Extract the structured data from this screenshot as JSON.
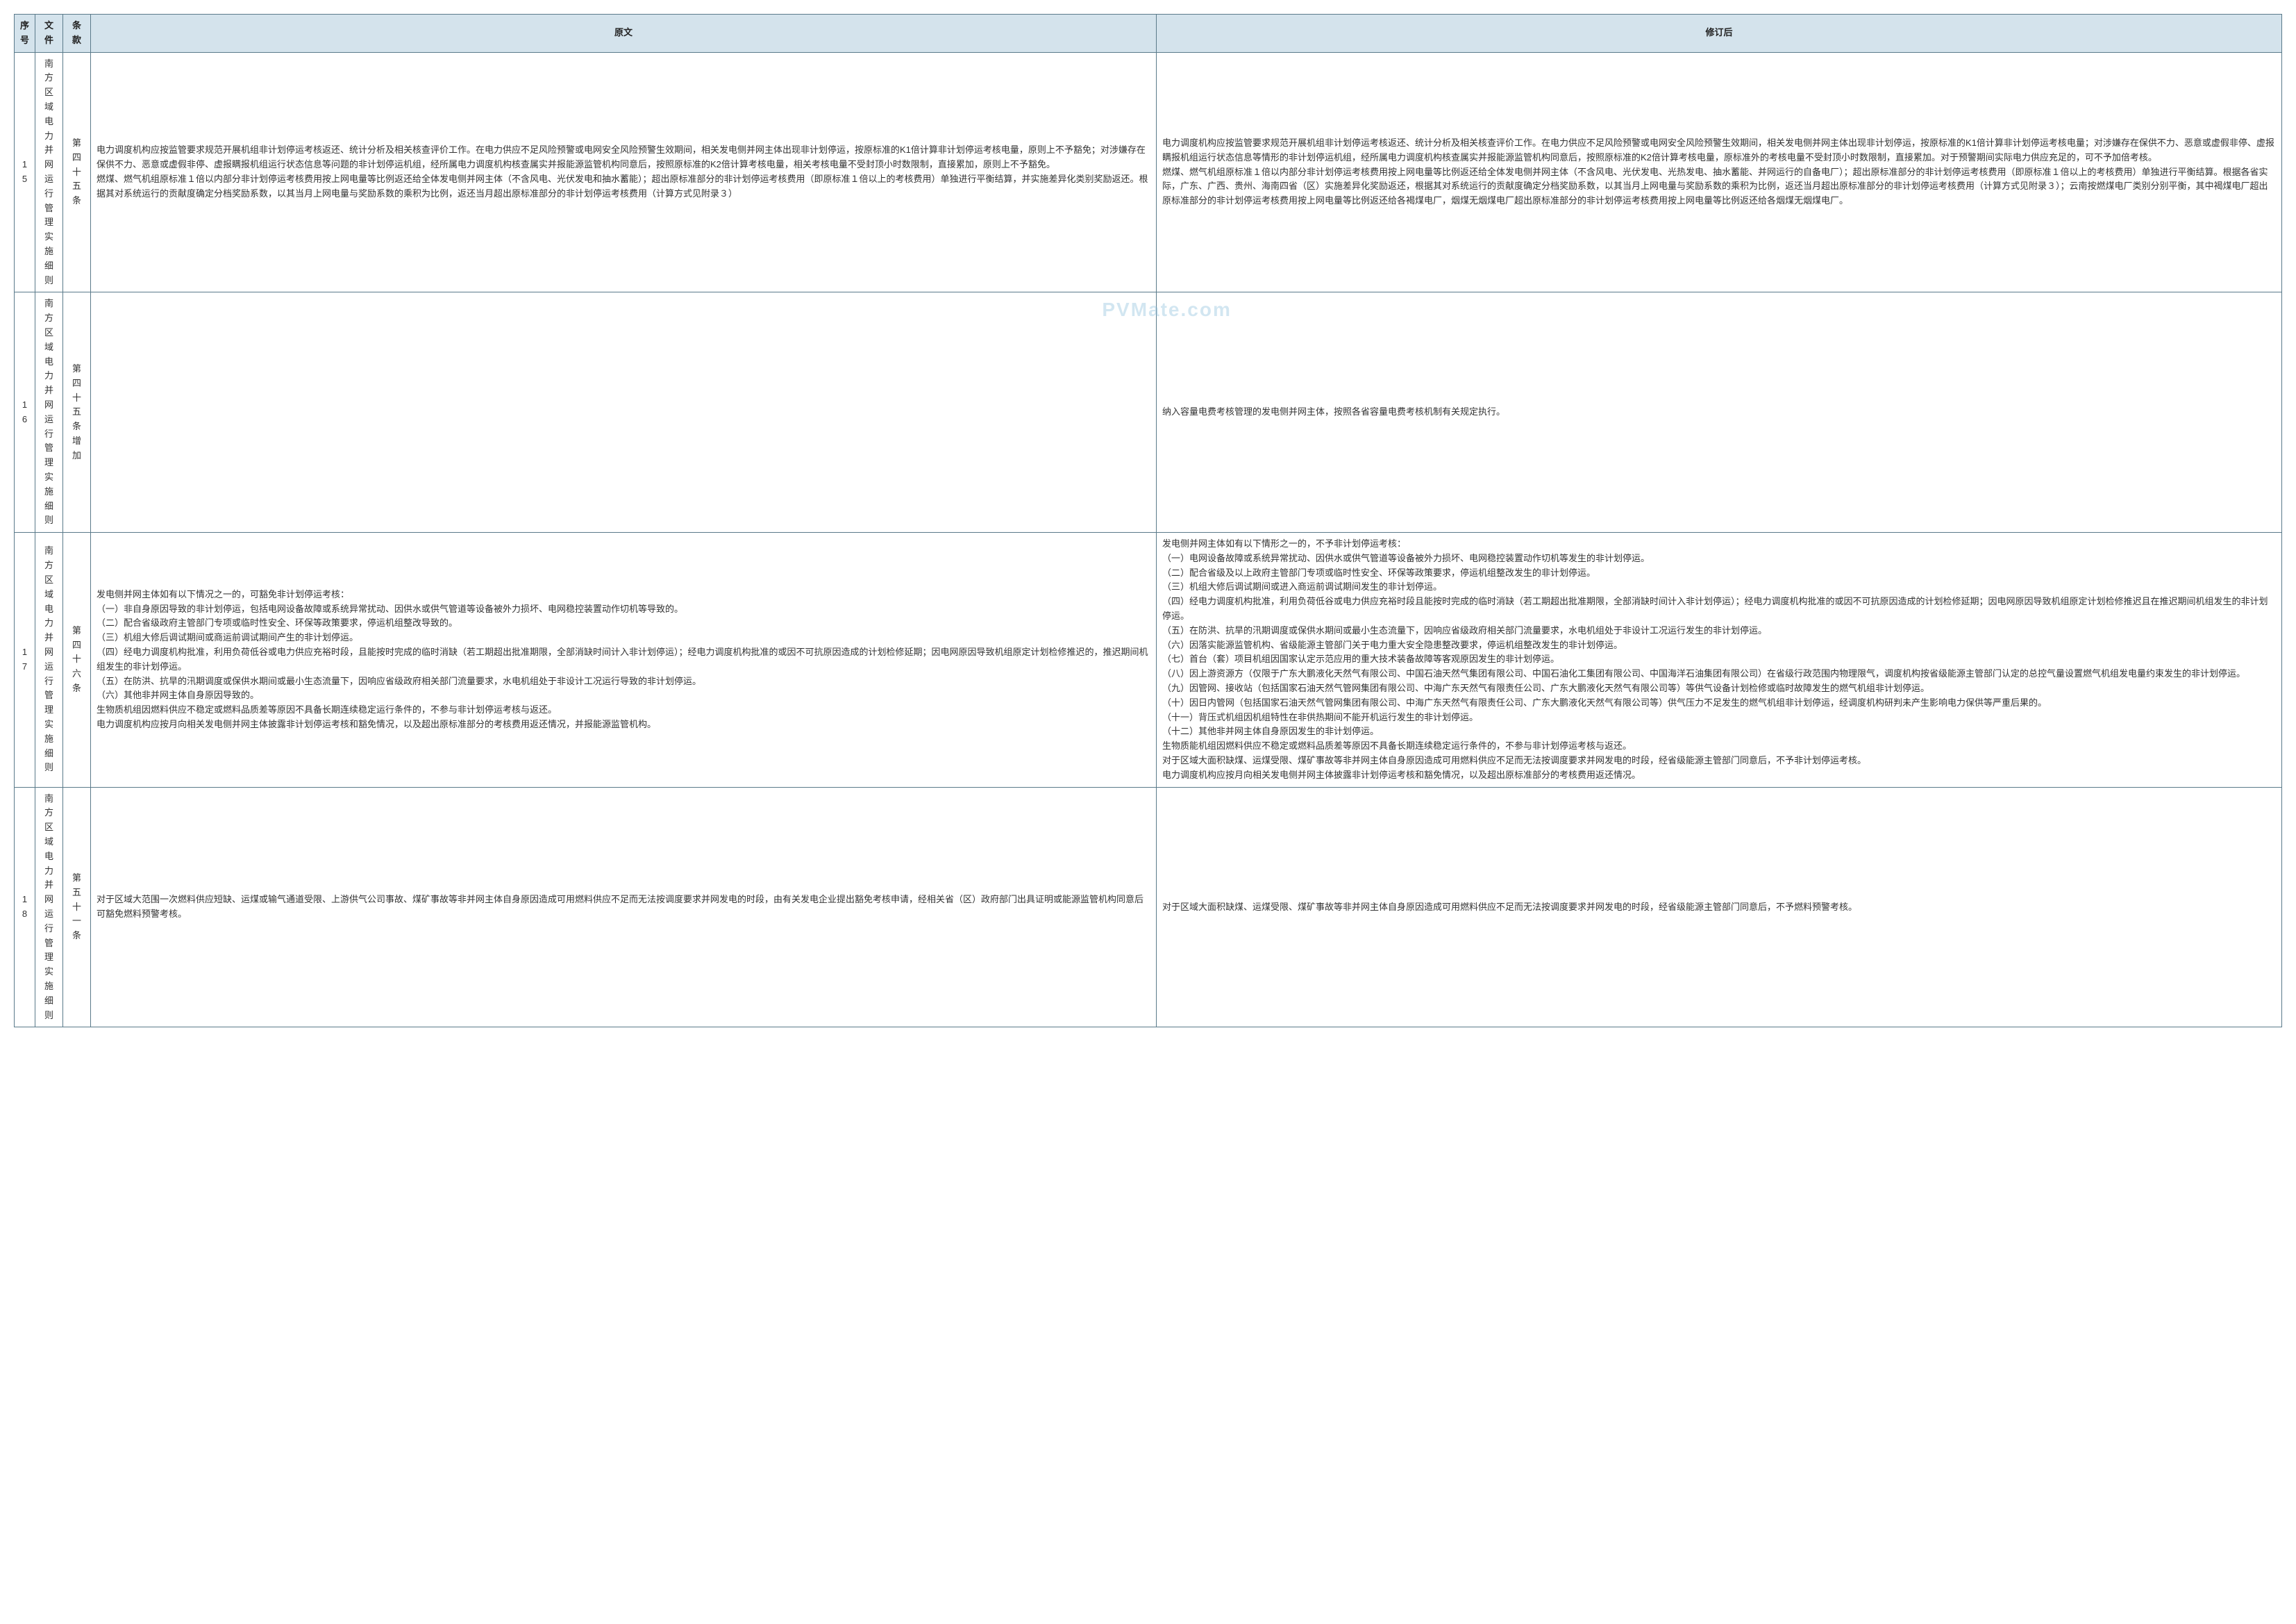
{
  "watermark": "PVMate.com",
  "headers": {
    "seq": "序号",
    "file": "文件",
    "clause": "条款",
    "original": "原文",
    "revised": "修订后"
  },
  "rows": [
    {
      "seq": "15",
      "file": "南方区域电力并网运行管理实施细则",
      "clause": "第四十五条",
      "original": "电力调度机构应按监管要求规范开展机组非计划停运考核返还、统计分析及相关核查评价工作。在电力供应不足风险预警或电网安全风险预警生效期间，相关发电侧并网主体出现非计划停运，按原标准的K1倍计算非计划停运考核电量，原则上不予豁免；对涉嫌存在保供不力、恶意或虚假非停、虚报瞒报机组运行状态信息等问题的非计划停运机组，经所属电力调度机构核查属实并报能源监管机构同意后，按照原标准的K2倍计算考核电量，相关考核电量不受封顶小时数限制，直接累加，原则上不予豁免。\n燃煤、燃气机组原标准１倍以内部分非计划停运考核费用按上网电量等比例返还给全体发电侧并网主体（不含风电、光伏发电和抽水蓄能）；超出原标准部分的非计划停运考核费用（即原标准１倍以上的考核费用）单独进行平衡结算，并实施差异化类别奖励返还。根据其对系统运行的贡献度确定分档奖励系数，以其当月上网电量与奖励系数的乘积为比例，返还当月超出原标准部分的非计划停运考核费用（计算方式见附录３）",
      "revised": "电力调度机构应按监管要求规范开展机组非计划停运考核返还、统计分析及相关核查评价工作。在电力供应不足风险预警或电网安全风险预警生效期间，相关发电侧并网主体出现非计划停运，按原标准的K1倍计算非计划停运考核电量；对涉嫌存在保供不力、恶意或虚假非停、虚报瞒报机组运行状态信息等情形的非计划停运机组，经所属电力调度机构核查属实并报能源监管机构同意后，按照原标准的K2倍计算考核电量，原标准外的考核电量不受封顶小时数限制，直接累加。对于预警期间实际电力供应充足的，可不予加倍考核。\n燃煤、燃气机组原标准１倍以内部分非计划停运考核费用按上网电量等比例返还给全体发电侧并网主体（不含风电、光伏发电、光热发电、抽水蓄能、并网运行的自备电厂）；超出原标准部分的非计划停运考核费用（即原标准１倍以上的考核费用）单独进行平衡结算。根据各省实际，广东、广西、贵州、海南四省（区）实施差异化奖励返还，根据其对系统运行的贡献度确定分档奖励系数，以其当月上网电量与奖励系数的乘积为比例，返还当月超出原标准部分的非计划停运考核费用（计算方式见附录３）；云南按燃煤电厂类别分别平衡，其中褐煤电厂超出原标准部分的非计划停运考核费用按上网电量等比例返还给各褐煤电厂，烟煤无烟煤电厂超出原标准部分的非计划停运考核费用按上网电量等比例返还给各烟煤无烟煤电厂。"
    },
    {
      "seq": "16",
      "file": "南方区域电力并网运行管理实施细则",
      "clause": "第四十五条增加",
      "original": "",
      "revised": "纳入容量电费考核管理的发电侧并网主体，按照各省容量电费考核机制有关规定执行。"
    },
    {
      "seq": "17",
      "file": "南方区域电力并网运行管理实施细则",
      "clause": "第四十六条",
      "original": "发电侧并网主体如有以下情况之一的，可豁免非计划停运考核：\n（一）非自身原因导致的非计划停运，包括电网设备故障或系统异常扰动、因供水或供气管道等设备被外力损坏、电网稳控装置动作切机等导致的。\n（二）配合省级政府主管部门专项或临时性安全、环保等政策要求，停运机组整改导致的。\n（三）机组大修后调试期间或商运前调试期间产生的非计划停运。\n（四）经电力调度机构批准，利用负荷低谷或电力供应充裕时段，且能按时完成的临时消缺（若工期超出批准期限，全部消缺时间计入非计划停运）；经电力调度机构批准的或因不可抗原因造成的计划检修延期；因电网原因导致机组原定计划检修推迟的，推迟期间机组发生的非计划停运。\n（五）在防洪、抗旱的汛期调度或保供水期间或最小生态流量下，因响应省级政府相关部门流量要求，水电机组处于非设计工况运行导致的非计划停运。\n（六）其他非并网主体自身原因导致的。\n生物质机组因燃料供应不稳定或燃料品质差等原因不具备长期连续稳定运行条件的，不参与非计划停运考核与返还。\n电力调度机构应按月向相关发电侧并网主体披露非计划停运考核和豁免情况，以及超出原标准部分的考核费用返还情况，并报能源监管机构。",
      "revised": "发电侧并网主体如有以下情形之一的，不予非计划停运考核：\n（一）电网设备故障或系统异常扰动、因供水或供气管道等设备被外力损坏、电网稳控装置动作切机等发生的非计划停运。\n（二）配合省级及以上政府主管部门专项或临时性安全、环保等政策要求，停运机组整改发生的非计划停运。\n（三）机组大修后调试期间或进入商运前调试期间发生的非计划停运。\n（四）经电力调度机构批准，利用负荷低谷或电力供应充裕时段且能按时完成的临时消缺（若工期超出批准期限，全部消缺时间计入非计划停运）；经电力调度机构批准的或因不可抗原因造成的计划检修延期；因电网原因导致机组原定计划检修推迟且在推迟期间机组发生的非计划停运。\n（五）在防洪、抗旱的汛期调度或保供水期间或最小生态流量下，因响应省级政府相关部门流量要求，水电机组处于非设计工况运行发生的非计划停运。\n（六）因落实能源监管机构、省级能源主管部门关于电力重大安全隐患整改要求，停运机组整改发生的非计划停运。\n（七）首台（套）项目机组因国家认定示范应用的重大技术装备故障等客观原因发生的非计划停运。\n（八）因上游资源方（仅限于广东大鹏液化天然气有限公司、中国石油天然气集团有限公司、中国石油化工集团有限公司、中国海洋石油集团有限公司）在省级行政范围内物理限气，调度机构按省级能源主管部门认定的总控气量设置燃气机组发电量约束发生的非计划停运。\n（九）因管网、接收站（包括国家石油天然气管网集团有限公司、中海广东天然气有限责任公司、广东大鹏液化天然气有限公司等）等供气设备计划检修或临时故障发生的燃气机组非计划停运。\n（十）因日内管网（包括国家石油天然气管网集团有限公司、中海广东天然气有限责任公司、广东大鹏液化天然气有限公司等）供气压力不足发生的燃气机组非计划停运，经调度机构研判未产生影响电力保供等严重后果的。\n（十一）背压式机组因机组特性在非供热期间不能开机运行发生的非计划停运。\n（十二）其他非并网主体自身原因发生的非计划停运。\n生物质能机组因燃料供应不稳定或燃料品质差等原因不具备长期连续稳定运行条件的，不参与非计划停运考核与返还。\n对于区域大面积缺煤、运煤受限、煤矿事故等非并网主体自身原因造成可用燃料供应不足而无法按调度要求并网发电的时段，经省级能源主管部门同意后，不予非计划停运考核。\n电力调度机构应按月向相关发电侧并网主体披露非计划停运考核和豁免情况，以及超出原标准部分的考核费用返还情况。"
    },
    {
      "seq": "18",
      "file": "南方区域电力并网运行管理实施细则",
      "clause": "第五十一条",
      "original": "对于区域大范围一次燃料供应短缺、运煤或输气通道受限、上游供气公司事故、煤矿事故等非并网主体自身原因造成可用燃料供应不足而无法按调度要求并网发电的时段，由有关发电企业提出豁免考核申请，经相关省（区）政府部门出具证明或能源监管机构同意后可豁免燃料预警考核。",
      "revised": "对于区域大面积缺煤、运煤受限、煤矿事故等非并网主体自身原因造成可用燃料供应不足而无法按调度要求并网发电的时段，经省级能源主管部门同意后，不予燃料预警考核。"
    }
  ]
}
